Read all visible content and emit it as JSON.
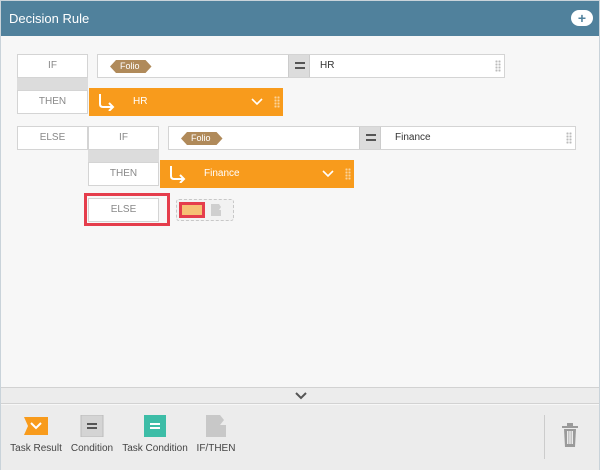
{
  "header": {
    "title": "Decision Rule",
    "add_icon": "plus-icon"
  },
  "rule": {
    "if_label": "IF",
    "then_label": "THEN",
    "else_label": "ELSE",
    "condition1": {
      "field": "Folio",
      "operator": "=",
      "value": "HR"
    },
    "result1": "HR",
    "nested": {
      "if_label": "IF",
      "then_label": "THEN",
      "else_label": "ELSE",
      "condition": {
        "field": "Folio",
        "operator": "=",
        "value": "Finance"
      },
      "result": "Finance"
    }
  },
  "palette": {
    "items": [
      {
        "label": "Task Result",
        "icon": "task-result-icon",
        "color": "#f89b1c"
      },
      {
        "label": "Condition",
        "icon": "condition-icon",
        "color": "#d4d4d4"
      },
      {
        "label": "Task Condition",
        "icon": "task-condition-icon",
        "color": "#3dbda7"
      },
      {
        "label": "IF/THEN",
        "icon": "if-then-icon",
        "color": "#c8c8c8"
      }
    ],
    "trash_icon": "trash-icon"
  },
  "colors": {
    "header": "#50819c",
    "result": "#f89b1c",
    "highlight": "#e53d4c"
  }
}
